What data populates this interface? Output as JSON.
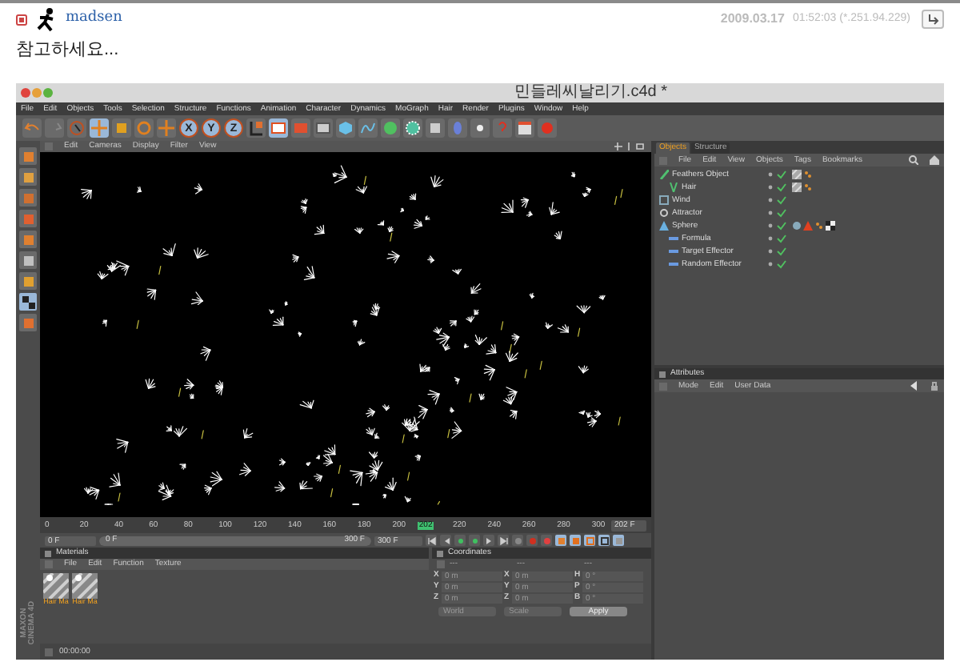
{
  "post": {
    "author": "madsen",
    "date": "2009.03.17",
    "time": "01:52:03 (*.251.94.229)",
    "body": "참고하세요..."
  },
  "app": {
    "title": "민들레씨날리기.c4d *",
    "menu": [
      "File",
      "Edit",
      "Objects",
      "Tools",
      "Selection",
      "Structure",
      "Functions",
      "Animation",
      "Character",
      "Dynamics",
      "MoGraph",
      "Hair",
      "Render",
      "Plugins",
      "Window",
      "Help"
    ],
    "axes": [
      "X",
      "Y",
      "Z"
    ],
    "viewport_menu": [
      "Edit",
      "Cameras",
      "Display",
      "Filter",
      "View"
    ],
    "object_tabs": [
      {
        "label": "Objects",
        "selected": true
      },
      {
        "label": "Structure",
        "selected": false
      }
    ],
    "object_menu": [
      "File",
      "Edit",
      "View",
      "Objects",
      "Tags",
      "Bookmarks"
    ],
    "objects": [
      {
        "name": "Feathers Object",
        "kind": "feather",
        "children": [
          {
            "name": "Hair",
            "kind": "hair"
          }
        ]
      },
      {
        "name": "Wind",
        "kind": "wind"
      },
      {
        "name": "Attractor",
        "kind": "attractor"
      },
      {
        "name": "Sphere",
        "kind": "sphere",
        "children": [
          {
            "name": "Formula",
            "kind": "effector"
          },
          {
            "name": "Target Effector",
            "kind": "effector"
          },
          {
            "name": "Random Effector",
            "kind": "effector"
          }
        ]
      }
    ],
    "attributes_title": "Attributes",
    "attributes_menu": [
      "Mode",
      "Edit",
      "User Data"
    ],
    "ruler": [
      "0",
      "20",
      "40",
      "60",
      "80",
      "100",
      "120",
      "140",
      "160",
      "180",
      "200",
      "220",
      "240",
      "260",
      "280",
      "300"
    ],
    "current_frame": "202",
    "current_field": "202 F",
    "start_field": "0 F",
    "range": {
      "start": "0 F",
      "end": "300 F",
      "level": 1
    },
    "end_field": "300 F",
    "materials_title": "Materials",
    "materials_menu": [
      "File",
      "Edit",
      "Function",
      "Texture"
    ],
    "materials": [
      "Hair Ma",
      "Hair Ma"
    ],
    "coordinates_title": "Coordinates",
    "coord_headers": [
      "---",
      "---",
      "---"
    ],
    "coords": [
      [
        {
          "axis": "X",
          "value": "0 m"
        },
        {
          "axis": "X",
          "value": "0 m"
        },
        {
          "axis": "H",
          "value": "0 °"
        }
      ],
      [
        {
          "axis": "Y",
          "value": "0 m"
        },
        {
          "axis": "Y",
          "value": "0 m"
        },
        {
          "axis": "P",
          "value": "0 °"
        }
      ],
      [
        {
          "axis": "Z",
          "value": "0 m"
        },
        {
          "axis": "Z",
          "value": "0 m"
        },
        {
          "axis": "B",
          "value": "0 °"
        }
      ]
    ],
    "coord_modes": [
      "World",
      "Scale"
    ],
    "apply": "Apply",
    "status_time": "00:00:00",
    "logo": [
      "MAXON",
      "CINEMA 4D"
    ]
  }
}
